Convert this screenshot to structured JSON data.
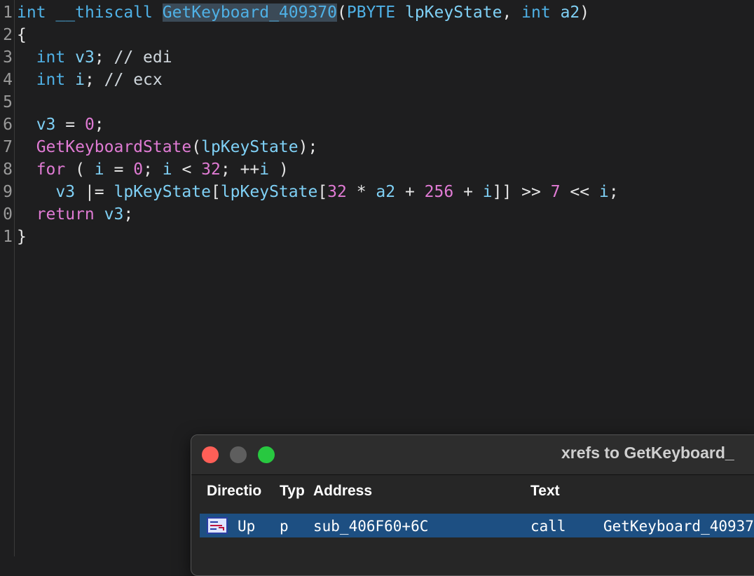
{
  "code_lines": [
    {
      "num": "1",
      "tokens": [
        {
          "t": "int",
          "c": "kw"
        },
        {
          "t": " ",
          "c": "punc"
        },
        {
          "t": "__thiscall",
          "c": "kw"
        },
        {
          "t": " ",
          "c": "punc"
        },
        {
          "t": "GetKeyboard_409370",
          "c": "fnhl"
        },
        {
          "t": "(",
          "c": "punc"
        },
        {
          "t": "PBYTE",
          "c": "kw"
        },
        {
          "t": " ",
          "c": "punc"
        },
        {
          "t": "lpKeyState",
          "c": "var"
        },
        {
          "t": ", ",
          "c": "punc"
        },
        {
          "t": "int",
          "c": "kw"
        },
        {
          "t": " ",
          "c": "punc"
        },
        {
          "t": "a2",
          "c": "var"
        },
        {
          "t": ")",
          "c": "punc"
        }
      ]
    },
    {
      "num": "2",
      "tokens": [
        {
          "t": "{",
          "c": "punc"
        }
      ]
    },
    {
      "num": "3",
      "tokens": [
        {
          "t": "  int",
          "c": "kw"
        },
        {
          "t": " ",
          "c": "punc"
        },
        {
          "t": "v3",
          "c": "var"
        },
        {
          "t": "; ",
          "c": "punc"
        },
        {
          "t": "// edi",
          "c": "cmt"
        }
      ]
    },
    {
      "num": "4",
      "tokens": [
        {
          "t": "  int",
          "c": "kw"
        },
        {
          "t": " ",
          "c": "punc"
        },
        {
          "t": "i",
          "c": "var"
        },
        {
          "t": "; ",
          "c": "punc"
        },
        {
          "t": "// ecx",
          "c": "cmt"
        }
      ]
    },
    {
      "num": "5",
      "tokens": []
    },
    {
      "num": "6",
      "tokens": [
        {
          "t": "  v3",
          "c": "var"
        },
        {
          "t": " = ",
          "c": "punc"
        },
        {
          "t": "0",
          "c": "num"
        },
        {
          "t": ";",
          "c": "punc"
        }
      ]
    },
    {
      "num": "7",
      "tokens": [
        {
          "t": "  GetKeyboardState",
          "c": "pink"
        },
        {
          "t": "(",
          "c": "punc"
        },
        {
          "t": "lpKeyState",
          "c": "var"
        },
        {
          "t": ");",
          "c": "punc"
        }
      ]
    },
    {
      "num": "8",
      "tokens": [
        {
          "t": "  for",
          "c": "pink"
        },
        {
          "t": " ( ",
          "c": "punc"
        },
        {
          "t": "i",
          "c": "var"
        },
        {
          "t": " = ",
          "c": "punc"
        },
        {
          "t": "0",
          "c": "num"
        },
        {
          "t": "; ",
          "c": "punc"
        },
        {
          "t": "i",
          "c": "var"
        },
        {
          "t": " < ",
          "c": "punc"
        },
        {
          "t": "32",
          "c": "num"
        },
        {
          "t": "; ++",
          "c": "punc"
        },
        {
          "t": "i",
          "c": "var"
        },
        {
          "t": " )",
          "c": "punc"
        }
      ]
    },
    {
      "num": "9",
      "tokens": [
        {
          "t": "    v3",
          "c": "var"
        },
        {
          "t": " |= ",
          "c": "punc"
        },
        {
          "t": "lpKeyState",
          "c": "var"
        },
        {
          "t": "[",
          "c": "punc"
        },
        {
          "t": "lpKeyState",
          "c": "var"
        },
        {
          "t": "[",
          "c": "punc"
        },
        {
          "t": "32",
          "c": "num"
        },
        {
          "t": " * ",
          "c": "punc"
        },
        {
          "t": "a2",
          "c": "var"
        },
        {
          "t": " + ",
          "c": "punc"
        },
        {
          "t": "256",
          "c": "num"
        },
        {
          "t": " + ",
          "c": "punc"
        },
        {
          "t": "i",
          "c": "var"
        },
        {
          "t": "]] >> ",
          "c": "punc"
        },
        {
          "t": "7",
          "c": "num"
        },
        {
          "t": " << ",
          "c": "punc"
        },
        {
          "t": "i",
          "c": "var"
        },
        {
          "t": ";",
          "c": "punc"
        }
      ]
    },
    {
      "num": "0",
      "tokens": [
        {
          "t": "  return",
          "c": "pink"
        },
        {
          "t": " ",
          "c": "punc"
        },
        {
          "t": "v3",
          "c": "var"
        },
        {
          "t": ";",
          "c": "punc"
        }
      ]
    },
    {
      "num": "1",
      "tokens": [
        {
          "t": "}",
          "c": "punc"
        }
      ]
    }
  ],
  "xrefs_window": {
    "title": "xrefs to GetKeyboard_",
    "columns": {
      "direction": "Directio",
      "type": "Typ",
      "address": "Address",
      "text": "Text"
    },
    "rows": [
      {
        "direction": "Up",
        "type": "p",
        "address": "sub_406F60+6C",
        "text_op": "call",
        "text_target": "GetKeyboard_40937"
      }
    ]
  }
}
